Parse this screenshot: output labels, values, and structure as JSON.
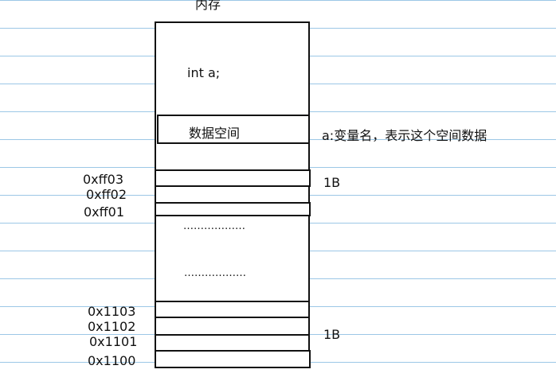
{
  "diagram": {
    "title": "内存",
    "declaration": "int a;",
    "data_space_label": "数据空间",
    "variable_note": "a:变量名，表示这个空间数据",
    "high_addresses": [
      "0xff03",
      "0xff02",
      "0xff01"
    ],
    "ellipsis_1": "………………",
    "ellipsis_2": "………………",
    "low_addresses": [
      "0x1103",
      "0x1102",
      "0x1101",
      "0x1100"
    ],
    "byte_label_top": "1B",
    "byte_label_bottom": "1B"
  },
  "colors": {
    "rule_line": "#9cc7e6",
    "stroke": "#111111"
  }
}
